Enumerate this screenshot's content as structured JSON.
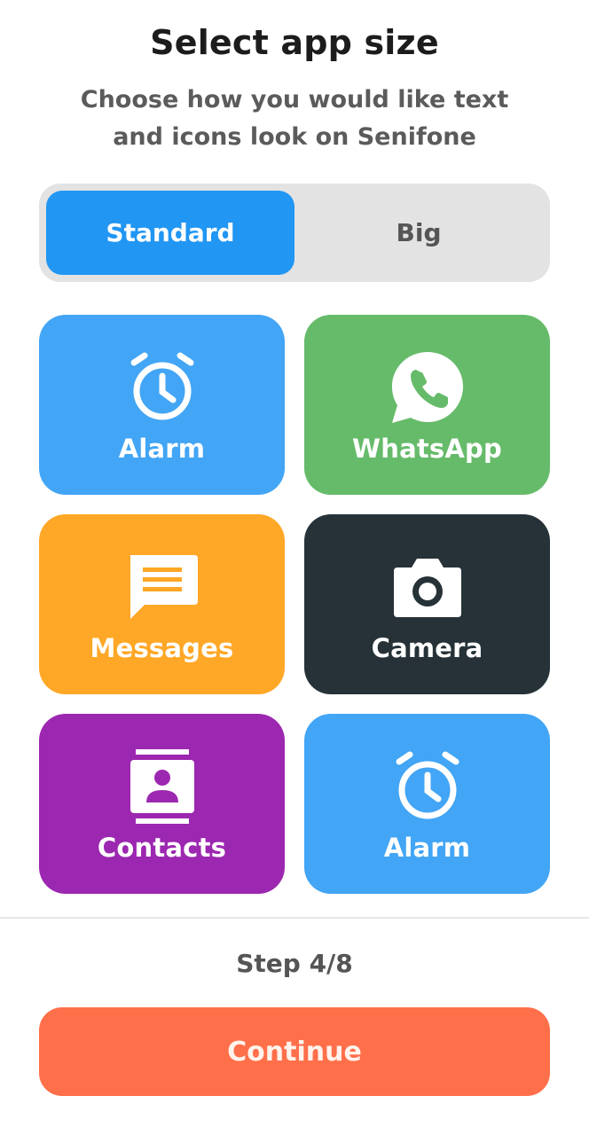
{
  "header": {
    "title": "Select app size",
    "subtitle": "Choose how you would like text and icons look on Senifone"
  },
  "size_toggle": {
    "options": [
      "Standard",
      "Big"
    ],
    "selected": "Standard",
    "colors": {
      "active": "#2196f3",
      "track": "#e3e3e3"
    }
  },
  "preview_tiles": [
    {
      "label": "Alarm",
      "icon": "alarm-clock-icon",
      "color": "#42a5f5"
    },
    {
      "label": "WhatsApp",
      "icon": "whatsapp-icon",
      "color": "#66bb6a"
    },
    {
      "label": "Messages",
      "icon": "message-icon",
      "color": "#ffa726"
    },
    {
      "label": "Camera",
      "icon": "camera-icon",
      "color": "#263238"
    },
    {
      "label": "Contacts",
      "icon": "contacts-icon",
      "color": "#9c27b0"
    },
    {
      "label": "Alarm",
      "icon": "alarm-clock-icon",
      "color": "#42a5f5"
    }
  ],
  "footer": {
    "step_text": "Step 4/8",
    "continue_label": "Continue",
    "continue_color": "#ff6f4a"
  }
}
